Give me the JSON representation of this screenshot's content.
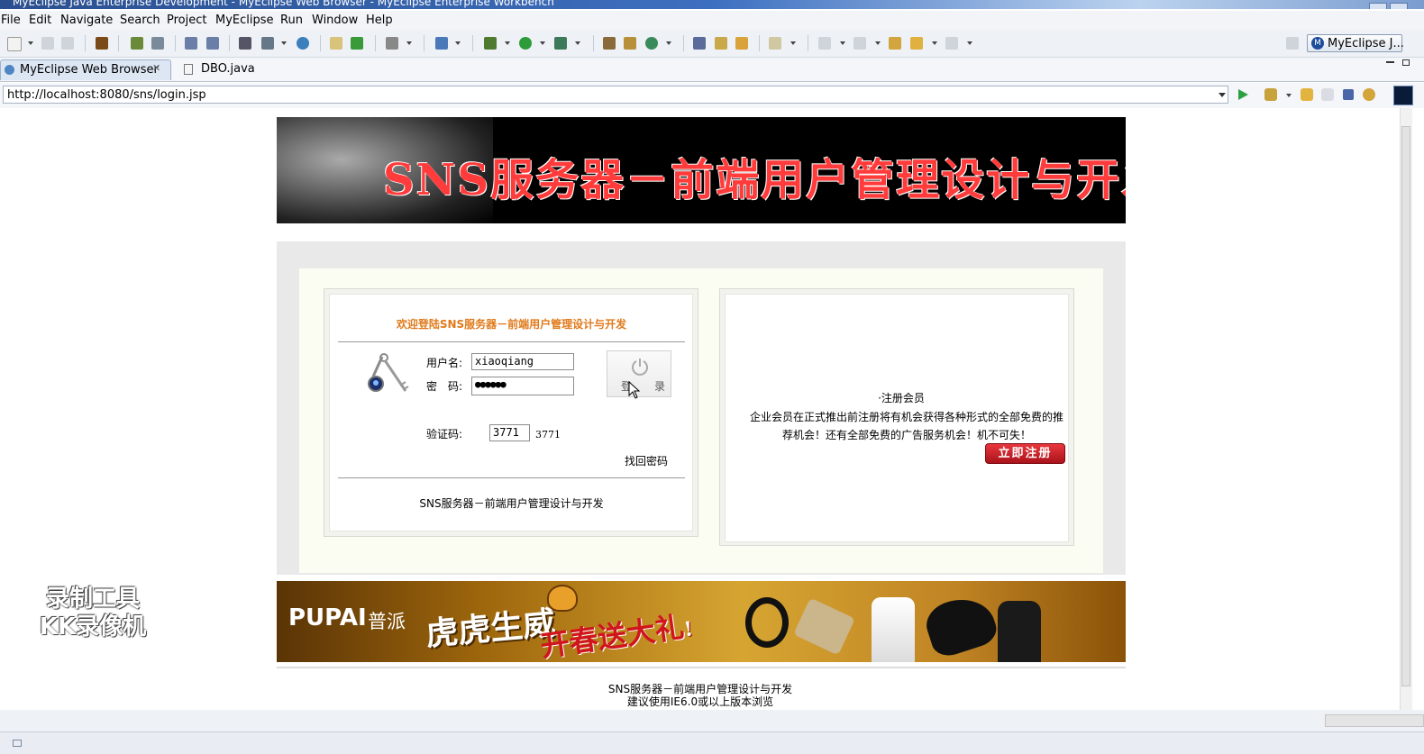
{
  "window": {
    "title": "MyEclipse Java Enterprise Development - MyEclipse Web Browser - MyEclipse Enterprise Workbench"
  },
  "menu": [
    "File",
    "Edit",
    "Navigate",
    "Search",
    "Project",
    "MyEclipse",
    "Run",
    "Window",
    "Help"
  ],
  "perspective": {
    "label": "MyEclipse J..."
  },
  "tabs": [
    {
      "label": "MyEclipse Web Browser",
      "icon": "globe-icon",
      "active": true
    },
    {
      "label": "DBO.java",
      "icon": "java-file-icon",
      "active": false
    }
  ],
  "browser": {
    "url": "http://localhost:8080/sns/login.jsp"
  },
  "page": {
    "banner_title": "SNS服务器－前端用户管理设计与开发",
    "login": {
      "welcome": "欢迎登陆SNS服务器－前端用户管理设计与开发",
      "username_label": "用户名:",
      "username_value": "xiaoqiang",
      "password_label": "密　码:",
      "password_value": "●●●●●●",
      "captcha_label": "验证码:",
      "captcha_value": "3771",
      "captcha_image_text": "3771",
      "login_button_left": "登",
      "login_button_right": "录",
      "forgot_password": "找回密码",
      "footer": "SNS服务器－前端用户管理设计与开发"
    },
    "register": {
      "heading": "·注册会员",
      "description": "企业会员在正式推出前注册将有机会获得各种形式的全部免费的推荐机会！还有全部免费的广告服务机会！机不可失！",
      "button": "立即注册"
    },
    "ad": {
      "brand": "PUPAI",
      "brand_cn": "普派",
      "slogan1": "虎虎生威",
      "slogan2": "开春送大礼",
      "slogan2_mark": "!"
    },
    "footer": {
      "line1": "SNS服务器－前端用户管理设计与开发",
      "line2": "建议使用IE6.0或以上版本浏览"
    }
  },
  "watermark": {
    "line1": "录制工具",
    "line2": "KK录像机"
  },
  "colors": {
    "accent_orange": "#e07a1b",
    "register_red": "#c0202a",
    "banner_red": "#ff3b3b"
  }
}
